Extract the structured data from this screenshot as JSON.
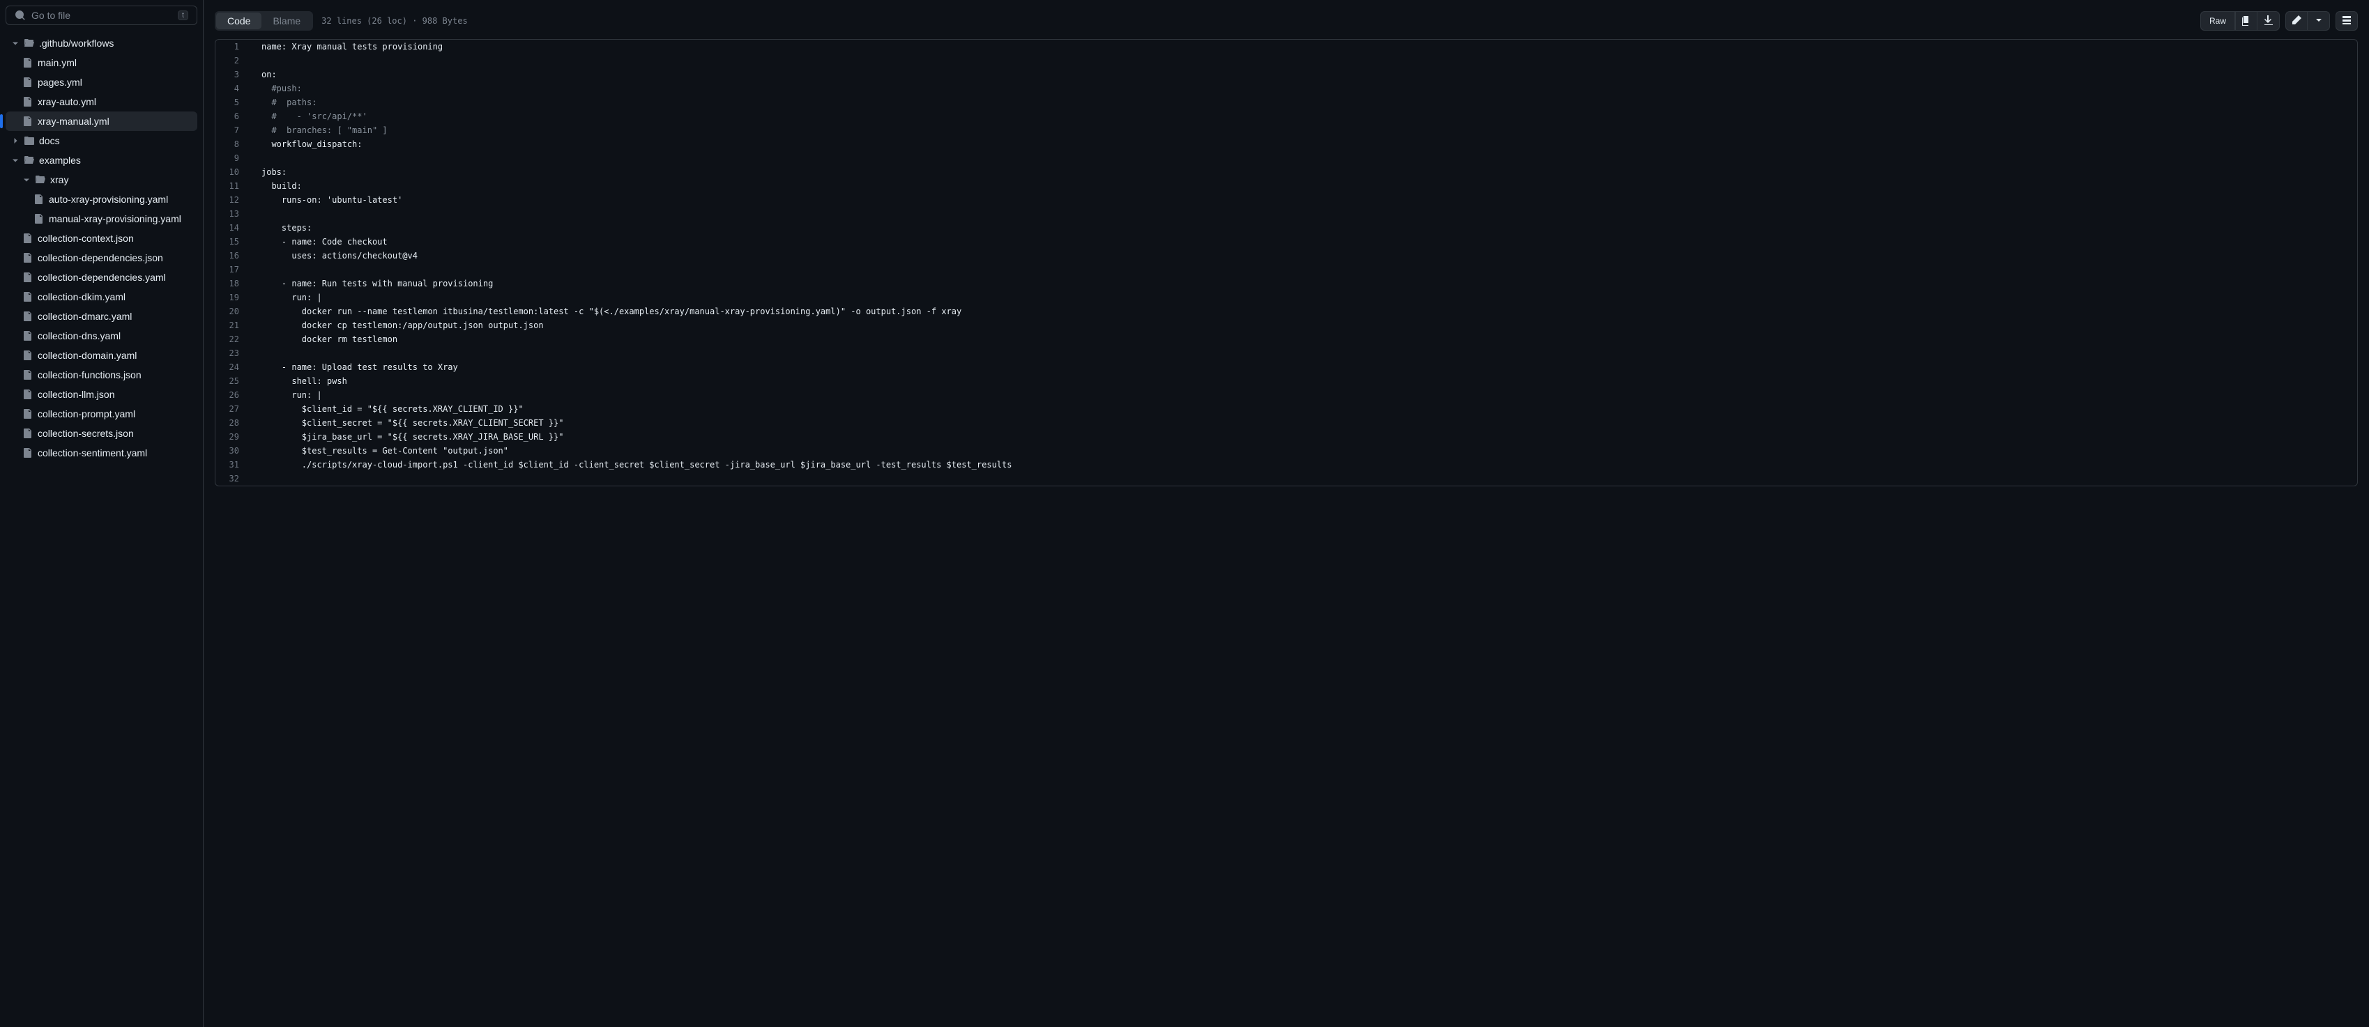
{
  "search": {
    "placeholder": "Go to file",
    "key": "t"
  },
  "tree": {
    "github_workflows": ".github/workflows",
    "main_yml": "main.yml",
    "pages_yml": "pages.yml",
    "xray_auto": "xray-auto.yml",
    "xray_manual": "xray-manual.yml",
    "docs": "docs",
    "examples": "examples",
    "xray": "xray",
    "auto_xray_prov": "auto-xray-provisioning.yaml",
    "manual_xray_prov": "manual-xray-provisioning.yaml",
    "collection_context": "collection-context.json",
    "collection_deps_json": "collection-dependencies.json",
    "collection_deps_yaml": "collection-dependencies.yaml",
    "collection_dkim": "collection-dkim.yaml",
    "collection_dmarc": "collection-dmarc.yaml",
    "collection_dns": "collection-dns.yaml",
    "collection_domain": "collection-domain.yaml",
    "collection_functions": "collection-functions.json",
    "collection_llm": "collection-llm.json",
    "collection_prompt": "collection-prompt.yaml",
    "collection_secrets": "collection-secrets.json",
    "collection_sentiment": "collection-sentiment.yaml"
  },
  "tabs": {
    "code": "Code",
    "blame": "Blame"
  },
  "file_info": "32 lines (26 loc) · 988 Bytes",
  "raw": "Raw",
  "code": {
    "l1": "name: Xray manual tests provisioning",
    "l2": "",
    "l3": "on:",
    "l4": "  #push:",
    "l5": "  #  paths:",
    "l6": "  #    - 'src/api/**'",
    "l7": "  #  branches: [ \"main\" ]",
    "l8": "  workflow_dispatch:",
    "l9": "",
    "l10": "jobs:",
    "l11": "  build:",
    "l12": "    runs-on: 'ubuntu-latest'",
    "l13": "",
    "l14": "    steps:",
    "l15": "    - name: Code checkout",
    "l16": "      uses: actions/checkout@v4",
    "l17": "",
    "l18": "    - name: Run tests with manual provisioning",
    "l19": "      run: |",
    "l20": "        docker run --name testlemon itbusina/testlemon:latest -c \"$(<./examples/xray/manual-xray-provisioning.yaml)\" -o output.json -f xray",
    "l21": "        docker cp testlemon:/app/output.json output.json",
    "l22": "        docker rm testlemon",
    "l23": "",
    "l24": "    - name: Upload test results to Xray",
    "l25": "      shell: pwsh",
    "l26": "      run: |",
    "l27": "        $client_id = \"${{ secrets.XRAY_CLIENT_ID }}\"",
    "l28": "        $client_secret = \"${{ secrets.XRAY_CLIENT_SECRET }}\"",
    "l29": "        $jira_base_url = \"${{ secrets.XRAY_JIRA_BASE_URL }}\"",
    "l30": "        $test_results = Get-Content \"output.json\"",
    "l31": "        ./scripts/xray-cloud-import.ps1 -client_id $client_id -client_secret $client_secret -jira_base_url $jira_base_url -test_results $test_results",
    "l32": ""
  },
  "line_nums": [
    "1",
    "2",
    "3",
    "4",
    "5",
    "6",
    "7",
    "8",
    "9",
    "10",
    "11",
    "12",
    "13",
    "14",
    "15",
    "16",
    "17",
    "18",
    "19",
    "20",
    "21",
    "22",
    "23",
    "24",
    "25",
    "26",
    "27",
    "28",
    "29",
    "30",
    "31",
    "32"
  ]
}
